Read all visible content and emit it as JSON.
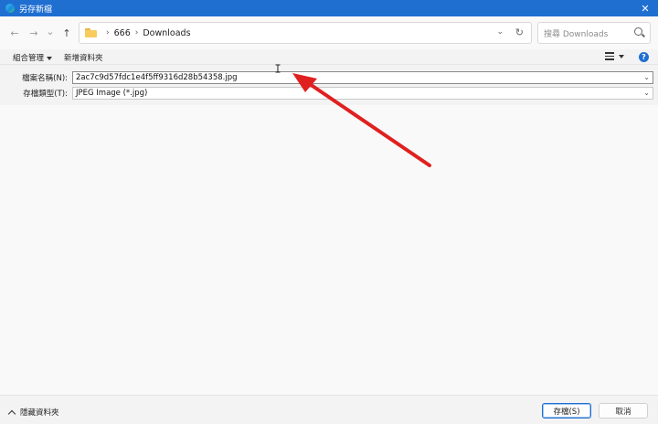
{
  "window": {
    "title": "另存新檔",
    "close_glyph": "✕"
  },
  "nav": {
    "back_glyph": "←",
    "forward_glyph": "→",
    "history_glyph": "⌄",
    "up_glyph": "↑",
    "breadcrumb": [
      "666",
      "Downloads"
    ],
    "breadcrumb_sep": "›",
    "dropdown_glyph": "⌄",
    "refresh_glyph": "↻"
  },
  "search": {
    "placeholder": "搜尋 Downloads"
  },
  "toolbar": {
    "organize_label": "組合管理",
    "new_folder_label": "新增資料夾",
    "help_glyph": "?"
  },
  "form": {
    "filename_label": "檔案名稱(N):",
    "filename_value": "2ac7c9d57fdc1e4f5ff9316d28b54358.jpg",
    "filetype_label": "存檔類型(T):",
    "filetype_value": "JPEG Image (*.jpg)",
    "dropdown_glyph": "⌄"
  },
  "footer": {
    "hide_folders_label": "隱藏資料夾",
    "save_label": "存檔(S)",
    "cancel_label": "取消"
  },
  "colors": {
    "titlebar": "#1f6fd1",
    "arrow": "#e02020",
    "accent": "#1f6fd1"
  }
}
